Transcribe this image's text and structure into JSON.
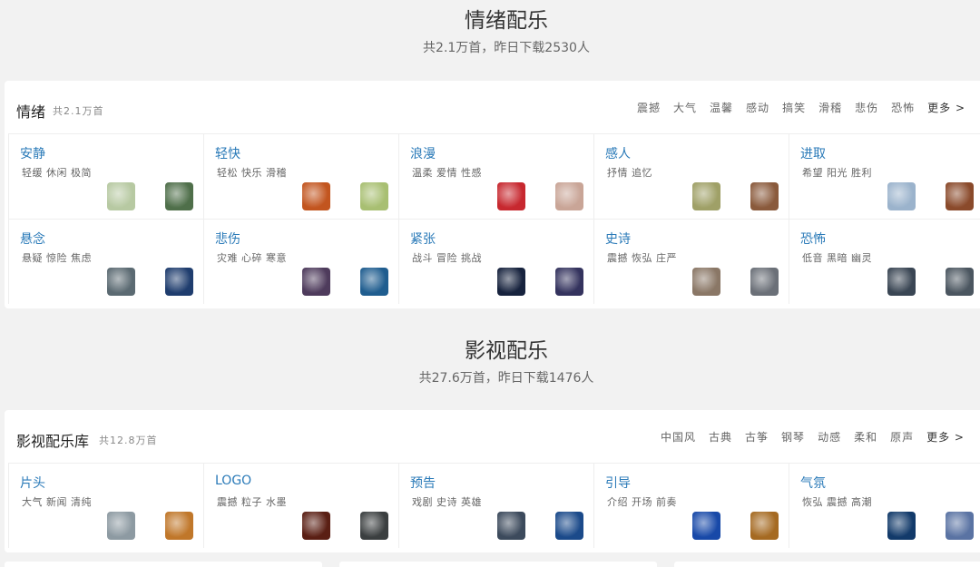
{
  "mood": {
    "title": "情绪配乐",
    "subtitle": "共2.1万首，昨日下载2530人",
    "panel_title": "情绪",
    "panel_count": "共2.1万首",
    "tags": [
      "震撼",
      "大气",
      "温馨",
      "感动",
      "搞笑",
      "滑稽",
      "悲伤",
      "恐怖"
    ],
    "more": "更多 >",
    "cells": [
      {
        "name": "安静",
        "tags": "轻缓 休闲 极简",
        "c1": "#b7c9a2",
        "c2": "#4f6f4a"
      },
      {
        "name": "轻快",
        "tags": "轻松 快乐 滑稽",
        "c1": "#c2551f",
        "c2": "#a8bf72"
      },
      {
        "name": "浪漫",
        "tags": "温柔 爱情 性感",
        "c1": "#c7282f",
        "c2": "#c9a597"
      },
      {
        "name": "感人",
        "tags": "抒情 追忆",
        "c1": "#9fa067",
        "c2": "#8a5a3c"
      },
      {
        "name": "进取",
        "tags": "希望 阳光 胜利",
        "c1": "#9bb3cc",
        "c2": "#8a4a2b"
      },
      {
        "name": "悬念",
        "tags": "悬疑 惊险 焦虑",
        "c1": "#5b6a72",
        "c2": "#1f3d6e"
      },
      {
        "name": "悲伤",
        "tags": "灾难 心碎 寒意",
        "c1": "#4e3b5c",
        "c2": "#1f5d8f"
      },
      {
        "name": "紧张",
        "tags": "战斗 冒险 挑战",
        "c1": "#17233e",
        "c2": "#34335e"
      },
      {
        "name": "史诗",
        "tags": "震撼 恢弘 庄严",
        "c1": "#8a7766",
        "c2": "#6b7078"
      },
      {
        "name": "恐怖",
        "tags": "低音 黑暗 幽灵",
        "c1": "#3a4654",
        "c2": "#4b5660"
      }
    ]
  },
  "film": {
    "title": "影视配乐",
    "subtitle": "共27.6万首，昨日下载1476人",
    "panel_title": "影视配乐库",
    "panel_count": "共12.8万首",
    "tags": [
      "中国风",
      "古典",
      "古筝",
      "钢琴",
      "动感",
      "柔和",
      "原声"
    ],
    "more": "更多 >",
    "cells": [
      {
        "name": "片头",
        "tags": "大气 新闻 清纯",
        "c1": "#8d9aa2",
        "c2": "#c0772a"
      },
      {
        "name": "LOGO",
        "tags": "震撼 粒子 水墨",
        "c1": "#5a1f14",
        "c2": "#3b3f40"
      },
      {
        "name": "预告",
        "tags": "戏剧 史诗 英雄",
        "c1": "#3c4a5c",
        "c2": "#1b4a8a"
      },
      {
        "name": "引导",
        "tags": "介绍 开场 前奏",
        "c1": "#1849a8",
        "c2": "#a56a22"
      },
      {
        "name": "气氛",
        "tags": "恢弘 震撼 高潮",
        "c1": "#123a6a",
        "c2": "#5a73a3"
      }
    ]
  }
}
